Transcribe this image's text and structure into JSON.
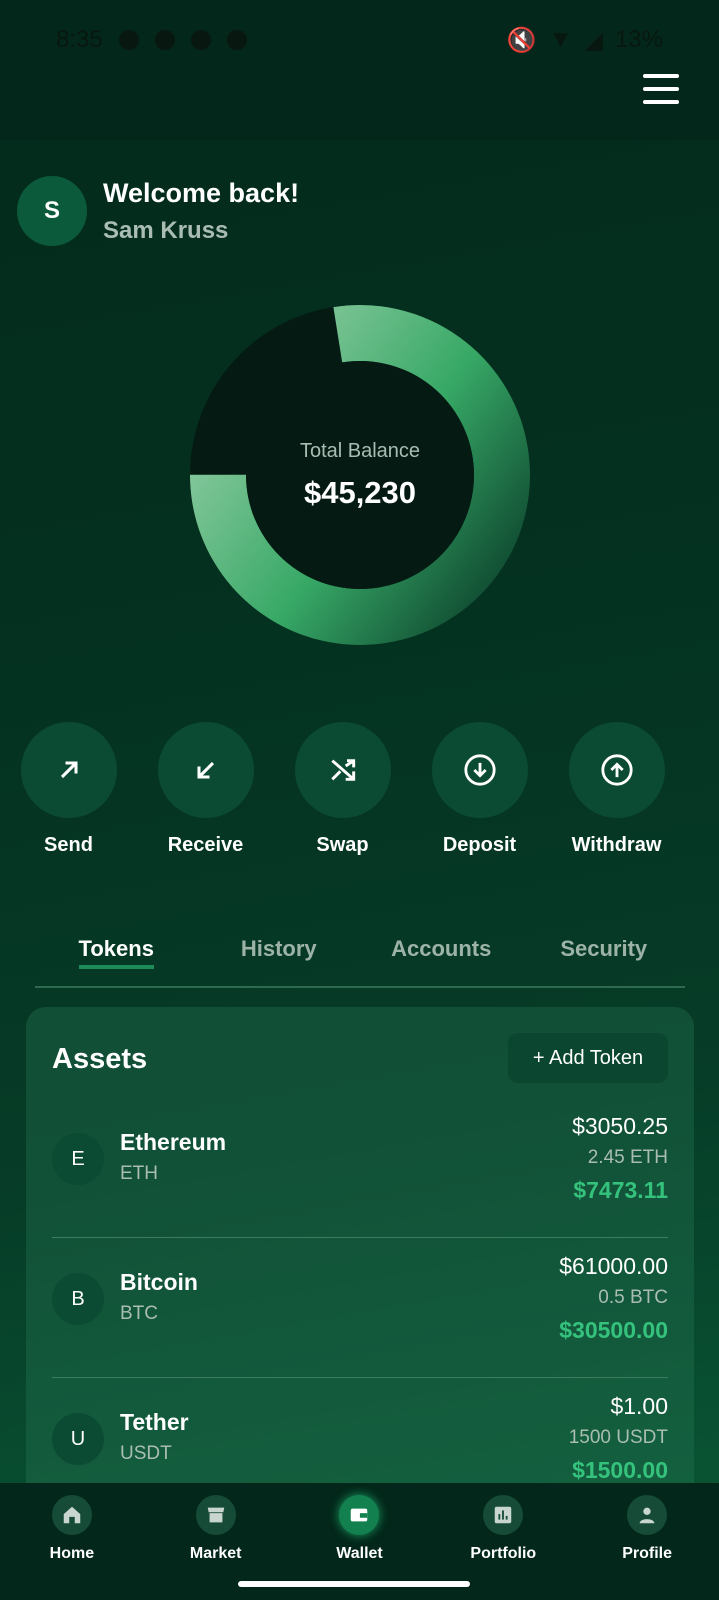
{
  "status_bar": {
    "time": "8:35",
    "battery": "13%"
  },
  "welcome": {
    "avatar_initial": "S",
    "greeting": "Welcome back!",
    "user_name": "Sam Kruss"
  },
  "balance": {
    "label": "Total Balance",
    "value": "$45,230"
  },
  "chart_data": {
    "type": "pie",
    "values": [
      77.5,
      22.5
    ],
    "colors": [
      "#3fae6b",
      "#041a12"
    ]
  },
  "actions": [
    {
      "label": "Send",
      "icon": "arrow-up-right-icon"
    },
    {
      "label": "Receive",
      "icon": "arrow-down-left-icon"
    },
    {
      "label": "Swap",
      "icon": "shuffle-icon"
    },
    {
      "label": "Deposit",
      "icon": "circle-arrow-down-icon"
    },
    {
      "label": "Withdraw",
      "icon": "circle-arrow-up-icon"
    }
  ],
  "tabs": [
    {
      "label": "Tokens",
      "active": true
    },
    {
      "label": "History",
      "active": false
    },
    {
      "label": "Accounts",
      "active": false
    },
    {
      "label": "Security",
      "active": false
    }
  ],
  "assets": {
    "title": "Assets",
    "add_button": "+ Add Token",
    "items": [
      {
        "initial": "E",
        "name": "Ethereum",
        "symbol": "ETH",
        "price": "$3050.25",
        "amount": "2.45 ETH",
        "total": "$7473.11"
      },
      {
        "initial": "B",
        "name": "Bitcoin",
        "symbol": "BTC",
        "price": "$61000.00",
        "amount": "0.5 BTC",
        "total": "$30500.00"
      },
      {
        "initial": "U",
        "name": "Tether",
        "symbol": "USDT",
        "price": "$1.00",
        "amount": "1500 USDT",
        "total": "$1500.00"
      }
    ]
  },
  "bottom_nav": [
    {
      "label": "Home",
      "icon": "home-icon",
      "active": false
    },
    {
      "label": "Market",
      "icon": "store-icon",
      "active": false
    },
    {
      "label": "Wallet",
      "icon": "wallet-icon",
      "active": true
    },
    {
      "label": "Portfolio",
      "icon": "bar-chart-icon",
      "active": false
    },
    {
      "label": "Profile",
      "icon": "person-icon",
      "active": false
    }
  ],
  "colors": {
    "accent": "#34c27d",
    "background": "#04301f"
  }
}
